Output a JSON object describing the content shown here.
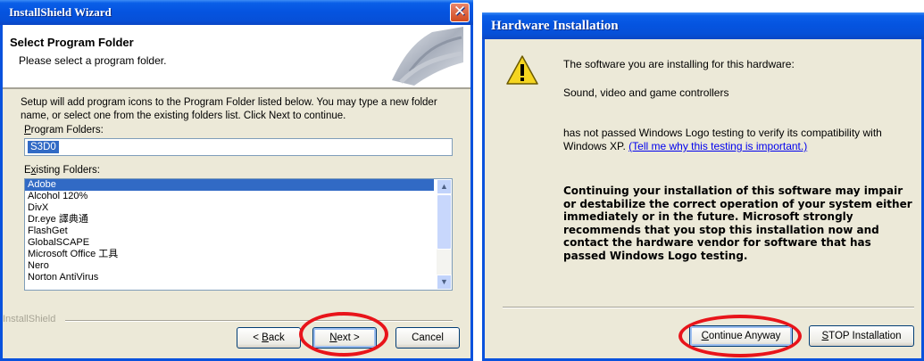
{
  "left_dialog": {
    "title": "InstallShield Wizard",
    "close_glyph": "✕",
    "header_title": "Select Program Folder",
    "header_subtitle": "Please select a program folder.",
    "description": "Setup will add program icons to the Program Folder listed below.  You may type a new folder name, or select one from the existing folders list.  Click Next to continue.",
    "program_folders_label_key": "P",
    "program_folders_label_rest": "rogram Folders:",
    "program_folder_value": "S3D0",
    "existing_folders_label_pre": "E",
    "existing_folders_label_key": "x",
    "existing_folders_label_rest": "isting Folders:",
    "existing_folders": [
      "Adobe",
      "Alcohol 120%",
      "DivX",
      "Dr.eye 譯典通",
      "FlashGet",
      "GlobalSCAPE",
      "Microsoft Office 工具",
      "Nero",
      "Norton AntiVirus"
    ],
    "selected_folder": "Adobe",
    "brand": "InstallShield",
    "buttons": {
      "back_glyph": "< ",
      "back_key": "B",
      "back_rest": "ack",
      "next_key": "N",
      "next_rest": "ext >",
      "cancel": "Cancel"
    }
  },
  "right_dialog": {
    "title": "Hardware Installation",
    "intro": "The software you are installing for this hardware:",
    "device": "Sound, video and game controllers",
    "logo_text": "has not passed Windows Logo testing to verify its compatibility with Windows XP. ",
    "logo_link": "(Tell me why this testing is important.)",
    "warning": "Continuing your installation of this software may impair or destabilize the correct operation of your system either immediately or in the future. Microsoft strongly recommends that you stop this installation now and contact the hardware vendor for software that has passed Windows Logo testing.",
    "buttons": {
      "continue_key": "C",
      "continue_rest": "ontinue Anyway",
      "stop_key": "S",
      "stop_rest": "TOP Installation"
    }
  },
  "colors": {
    "title_blue": "#0554e0",
    "selection_blue": "#316ac5",
    "dialog_bg": "#ece9d8",
    "annotation_red": "#e8141a",
    "warning_yellow": "#f5d520"
  },
  "icons": [
    "close-icon",
    "scroll-up-arrow-icon",
    "scroll-down-arrow-icon",
    "warning-icon",
    "installer-page-curl-graphic"
  ]
}
